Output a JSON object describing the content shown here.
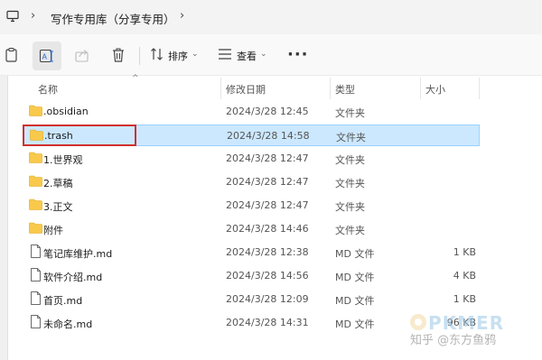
{
  "address_bar": {
    "crumb": "写作专用库（分享专用）",
    "separator": "›"
  },
  "toolbar": {
    "sort_label": "排序",
    "view_label": "查看",
    "more": "···"
  },
  "columns": {
    "name": "名称",
    "modified": "修改日期",
    "type": "类型",
    "size": "大小"
  },
  "files": [
    {
      "name": ".obsidian",
      "modified": "2024/3/28 12:45",
      "type": "文件夹",
      "size": "",
      "kind": "folder-icon"
    },
    {
      "name": ".trash",
      "modified": "2024/3/28 14:58",
      "type": "文件夹",
      "size": "",
      "kind": "folder-icon",
      "selected": true
    },
    {
      "name": "1.世界观",
      "modified": "2024/3/28 12:47",
      "type": "文件夹",
      "size": "",
      "kind": "folder-icon"
    },
    {
      "name": "2.草稿",
      "modified": "2024/3/28 12:47",
      "type": "文件夹",
      "size": "",
      "kind": "folder-icon"
    },
    {
      "name": "3.正文",
      "modified": "2024/3/28 12:47",
      "type": "文件夹",
      "size": "",
      "kind": "folder-icon"
    },
    {
      "name": "附件",
      "modified": "2024/3/28 14:46",
      "type": "文件夹",
      "size": "",
      "kind": "folder-icon"
    },
    {
      "name": "笔记库维护.md",
      "modified": "2024/3/28 12:38",
      "type": "MD 文件",
      "size": "1 KB",
      "kind": "document-icon"
    },
    {
      "name": "软件介绍.md",
      "modified": "2024/3/28 14:56",
      "type": "MD 文件",
      "size": "4 KB",
      "kind": "document-icon"
    },
    {
      "name": "首页.md",
      "modified": "2024/3/28 12:09",
      "type": "MD 文件",
      "size": "1 KB",
      "kind": "document-icon"
    },
    {
      "name": "未命名.md",
      "modified": "2024/3/28 14:31",
      "type": "MD 文件",
      "size": "96 KB",
      "kind": "document-icon"
    }
  ],
  "watermark": {
    "brand": "PKMER",
    "credit": "知乎 @东方鱼鸦"
  },
  "colors": {
    "selection_fill": "#cce8ff",
    "selection_border": "#99d1ff",
    "highlight_box": "#d0312d",
    "folder": "#f8c94b"
  }
}
